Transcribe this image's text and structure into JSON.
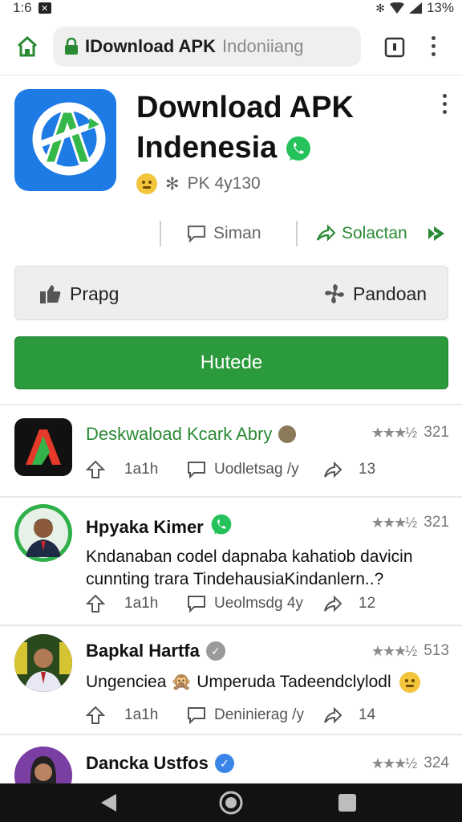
{
  "status": {
    "time": "1:6",
    "battery": "13%"
  },
  "browser": {
    "url_main": "IDownload APK",
    "url_sub": "Indoniiang"
  },
  "app": {
    "title_line1": "Download APK",
    "title_line2": "Indenesia",
    "meta_text": "PK 4y130",
    "action_share": "Siman",
    "action_select": "Solactan",
    "grey_left": "Prapg",
    "grey_right": "Pandoan",
    "install_label": "Hutede"
  },
  "list": [
    {
      "title": "Deskwaload Kcark Abry",
      "rating": "321",
      "stars": "★★★½",
      "like_count": "1a1h",
      "comment_label": "Uodletsag /y",
      "share_count": "13"
    },
    {
      "title": "Hpyaka Kimer",
      "rating": "321",
      "stars": "★★★½",
      "desc": "Kndanaban codel dapnaba kahatiob davicin cunnting trara TindehausiaKindanlern..?",
      "like_count": "1a1h",
      "comment_label": "Ueolmsdg 4y",
      "share_count": "12"
    },
    {
      "title": "Bapkal Hartfa",
      "rating": "513",
      "stars": "★★★½",
      "desc": "Ungenciea 🙊 Umperuda Tadeendclylodl",
      "like_count": "1a1h",
      "comment_label": "Deninierag /y",
      "share_count": "14"
    },
    {
      "title": "Dancka Ustfos",
      "rating": "324",
      "stars": "★★★½"
    }
  ],
  "colors": {
    "brand_green": "#2a9a3c",
    "icon_blue": "#1e7be6",
    "whatsapp_green": "#25c15a"
  },
  "icons": [
    "home-icon",
    "lock-icon",
    "tabs-icon",
    "more-vert-icon",
    "whatsapp-icon",
    "share-icon",
    "select-icon",
    "thumbs-up-icon",
    "fan-icon",
    "upvote-icon",
    "comment-icon",
    "forward-icon",
    "back-icon",
    "home-circle-icon",
    "recents-icon"
  ]
}
